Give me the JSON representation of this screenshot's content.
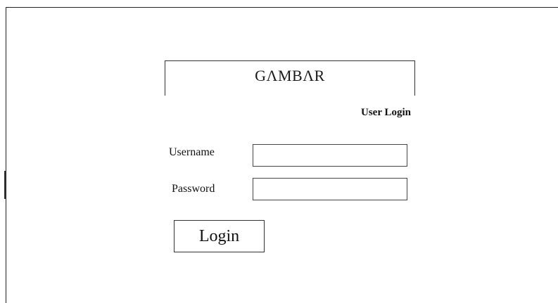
{
  "header": {
    "title": "GΛMBΛR"
  },
  "login_form": {
    "subtitle": "User Login",
    "username_label": "Username",
    "username_value": "",
    "password_label": "Password",
    "password_value": "",
    "login_button_label": "Login"
  },
  "colors": {
    "border": "#333333",
    "background": "#ffffff",
    "text": "#111111"
  }
}
